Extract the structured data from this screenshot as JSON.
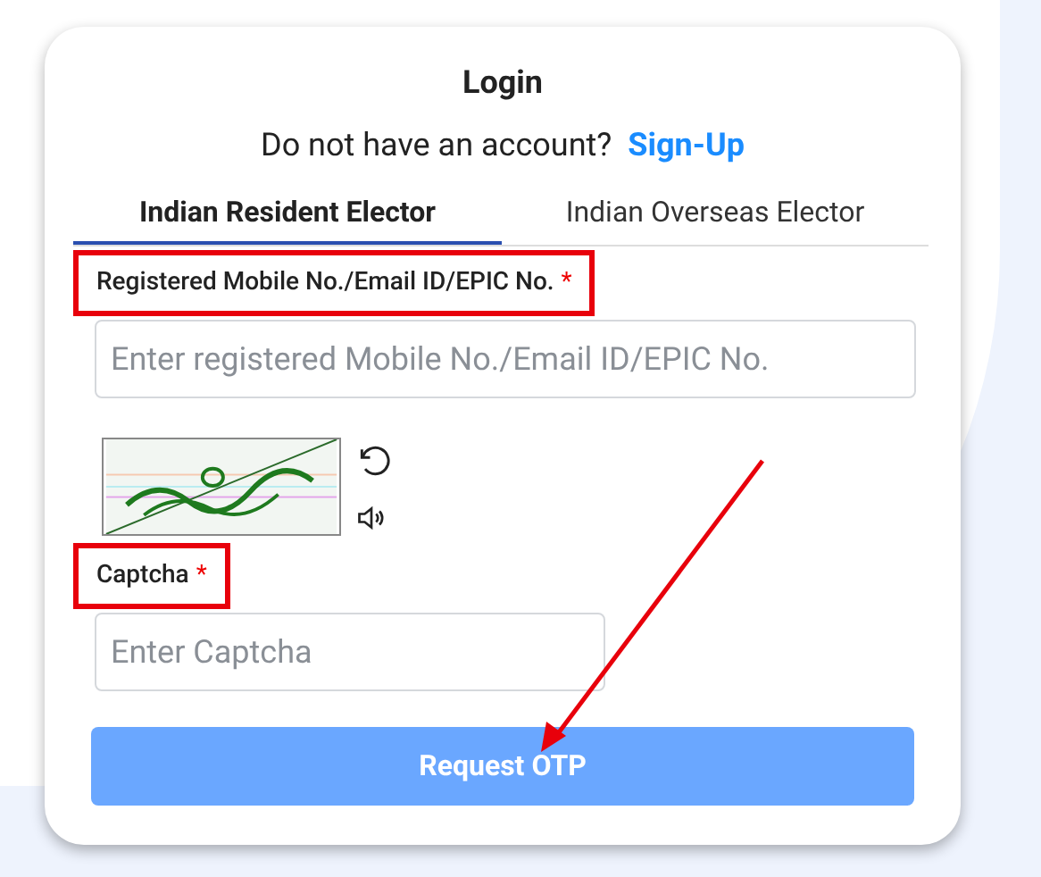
{
  "title": "Login",
  "signup_prompt": {
    "text": "Do not have an account?",
    "link": "Sign-Up"
  },
  "tabs": [
    {
      "label": "Indian Resident Elector",
      "selected": true
    },
    {
      "label": "Indian Overseas Elector",
      "selected": false
    }
  ],
  "fields": [
    {
      "label": "Registered Mobile No./Email ID/EPIC No.",
      "required": true,
      "required_mark": "*",
      "placeholder": "Enter registered Mobile No./Email ID/EPIC No.",
      "highlighted": true
    },
    {
      "kind": "captcha",
      "label": "Captcha",
      "required": true,
      "required_mark": "*",
      "placeholder": "Enter Captcha",
      "highlighted": true
    }
  ],
  "submit": {
    "label": "Request OTP",
    "disabled": true
  }
}
